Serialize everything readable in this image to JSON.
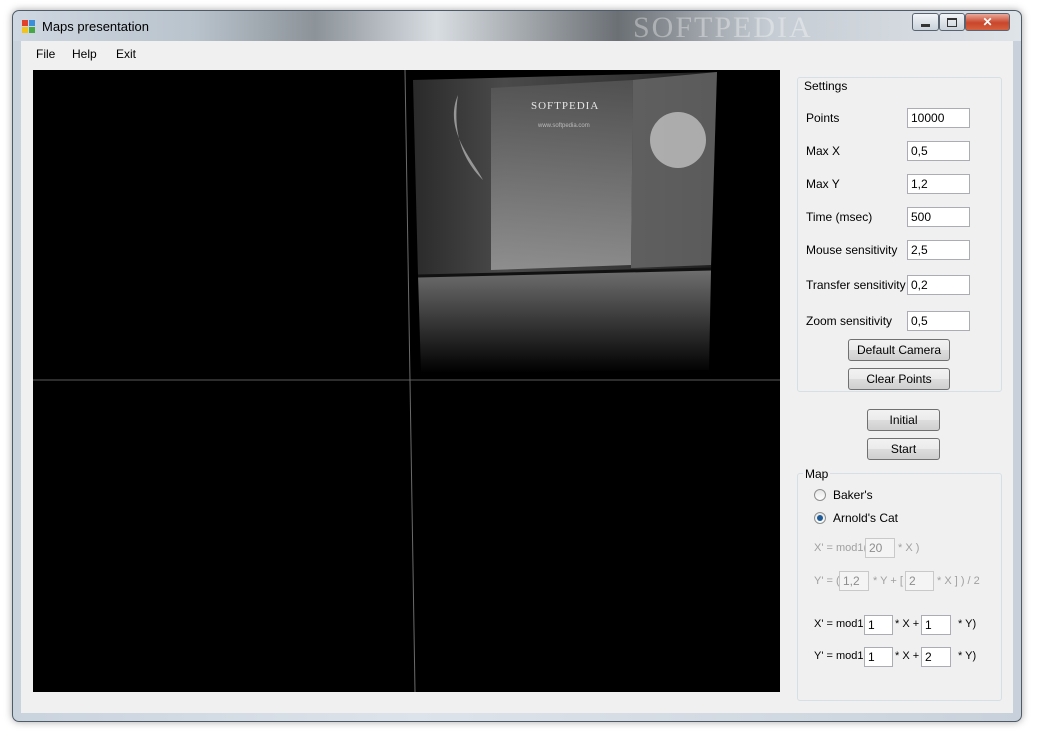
{
  "window": {
    "title": "Maps presentation",
    "watermark": "SOFTPEDIA"
  },
  "menu": [
    "File",
    "Help",
    "Exit"
  ],
  "viewport": {
    "brand": "SOFTPEDIA",
    "site": "www.softpedia.com"
  },
  "settings": {
    "title": "Settings",
    "fields": [
      {
        "label": "Points",
        "value": "10000"
      },
      {
        "label": "Max X",
        "value": "0,5"
      },
      {
        "label": "Max Y",
        "value": "1,2"
      },
      {
        "label": "Time (msec)",
        "value": "500"
      },
      {
        "label": "Mouse sensitivity",
        "value": "2,5"
      },
      {
        "label": "Transfer sensitivity",
        "value": "0,2"
      },
      {
        "label": "Zoom sensitivity",
        "value": "0,5"
      }
    ],
    "default_camera": "Default Camera",
    "clear_points": "Clear Points"
  },
  "actions": {
    "initial": "Initial",
    "start": "Start"
  },
  "map": {
    "title": "Map",
    "options": [
      "Baker's",
      "Arnold's Cat"
    ],
    "selected": "Arnold's Cat",
    "baker": {
      "x_prefix": "X' = mod1(",
      "x_value": "20",
      "x_suffix": "* X )",
      "y_prefix": "Y' = (",
      "y_value1": "1,2",
      "y_mid": "* Y + [",
      "y_value2": "2",
      "y_suffix": "* X ] ) / 2"
    },
    "cat": {
      "x_prefix": "X' = mod1(",
      "x_a": "1",
      "x_mid": "* X +",
      "x_b": "1",
      "x_suffix": "* Y)",
      "y_prefix": "Y' = mod1(",
      "y_a": "1",
      "y_mid": "* X +",
      "y_b": "2",
      "y_suffix": "* Y)"
    }
  }
}
